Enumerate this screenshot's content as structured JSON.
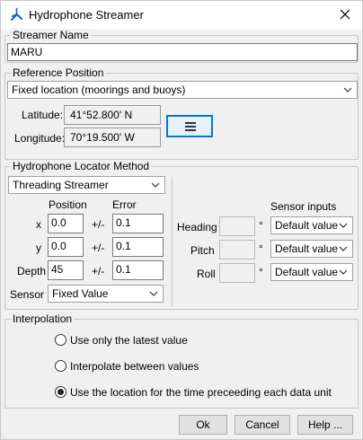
{
  "window": {
    "title": "Hydrophone Streamer",
    "app_icon": "java-icon",
    "close_icon": "close-icon"
  },
  "streamer_name": {
    "legend": "Streamer Name",
    "value": "MARU"
  },
  "reference_position": {
    "legend": "Reference Position",
    "selected": "Fixed location (moorings and buoys)",
    "latitude_label": "Latitude:",
    "latitude_value": "41°52.800' N",
    "longitude_label": "Longitude:",
    "longitude_value": "70°19.500' W",
    "menu_icon": "hamburger-menu-icon"
  },
  "locator": {
    "legend": "Hydrophone Locator Method",
    "method_selected": "Threading Streamer",
    "position_header": "Position",
    "error_header": "Error",
    "rows": [
      {
        "label": "x",
        "position": "0.0",
        "pm": "+/-",
        "error": "0.1"
      },
      {
        "label": "y",
        "position": "0.0",
        "pm": "+/-",
        "error": "0.1"
      },
      {
        "label": "Depth",
        "position": "45",
        "pm": "+/-",
        "error": "0.1"
      }
    ],
    "sensor_label": "Sensor",
    "sensor_selected": "Fixed Value",
    "sensor_inputs_header": "Sensor inputs",
    "orientation": [
      {
        "label": "Heading",
        "unit": "°",
        "selected": "Default value"
      },
      {
        "label": "Pitch",
        "unit": "°",
        "selected": "Default value"
      },
      {
        "label": "Roll",
        "unit": "°",
        "selected": "Default value"
      }
    ]
  },
  "interpolation": {
    "legend": "Interpolation",
    "options": [
      {
        "label": "Use only the latest value",
        "selected": false
      },
      {
        "label": "Interpolate between values",
        "selected": false
      },
      {
        "label": "Use the location for the time preceeding each data unit",
        "selected": true
      }
    ]
  },
  "buttons": {
    "ok": "Ok",
    "cancel": "Cancel",
    "help": "Help ..."
  },
  "colors": {
    "focus_accent": "#0078d7",
    "dialog_bg": "#f0f0f0"
  }
}
